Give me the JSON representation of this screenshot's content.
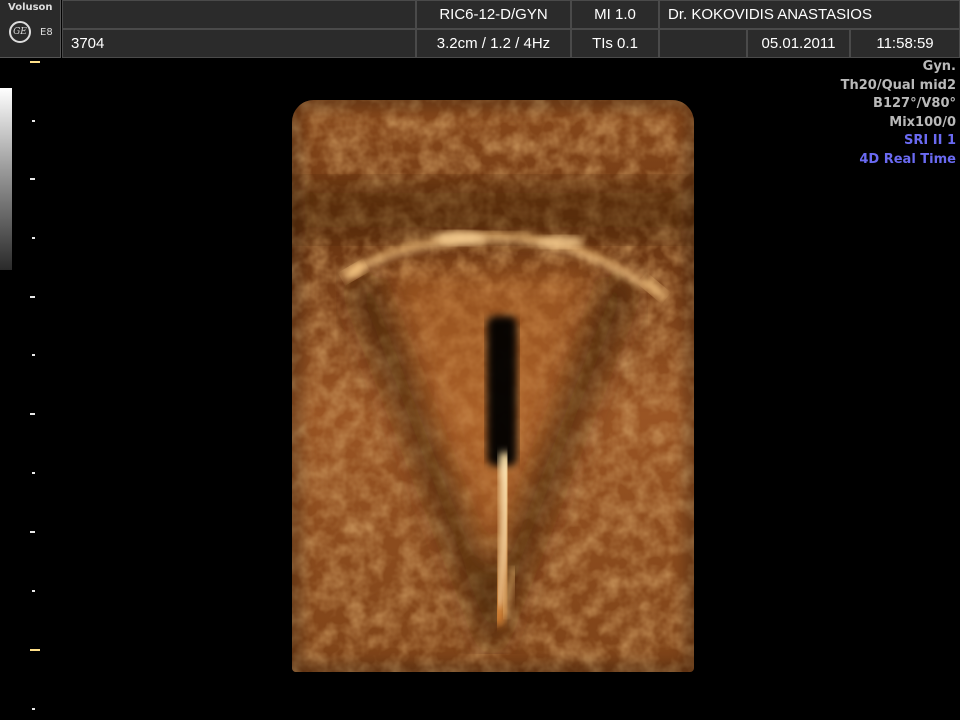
{
  "brand": {
    "name": "Voluson",
    "logo_text": "GE",
    "model": "E8"
  },
  "header": {
    "row1": {
      "probe": "RIC6-12-D/GYN",
      "mi": "MI  1.0",
      "physician": "Dr. KOKOVIDIS ANASTASIOS"
    },
    "row2": {
      "patient_id": "3704",
      "depth_info": "3.2cm / 1.2 /  4Hz",
      "tis": "TIs  0.1",
      "date": "05.01.2011",
      "time": "11:58:59"
    }
  },
  "info_panel": {
    "lines": [
      {
        "text": "Gyn.",
        "color": "gray"
      },
      {
        "text": "Th20/Qual mid2",
        "color": "gray"
      },
      {
        "text": "B127°/V80°",
        "color": "gray"
      },
      {
        "text": "Mix100/0",
        "color": "gray"
      },
      {
        "text": "SRI II 1",
        "color": "blue"
      },
      {
        "text": "4D Real Time",
        "color": "blue"
      }
    ]
  },
  "colors": {
    "header_cell_bg": "#2b2b2b",
    "info_gray": "#b9b9b9",
    "info_blue": "#6a6af2",
    "render_tone": "#b0622a"
  },
  "viewport": {
    "image": "3D/4D rendered ultrasound volume (sepia tone)"
  }
}
